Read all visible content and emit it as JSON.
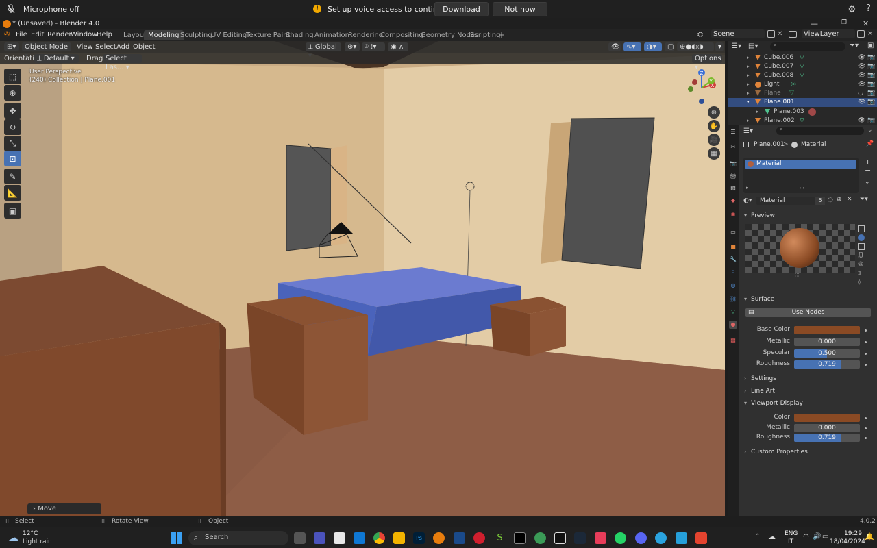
{
  "voice_bar": {
    "mic_label": "Microphone off",
    "warning_text": "Set up voice access to continue",
    "download_label": "Download",
    "not_now_label": "Not now"
  },
  "window": {
    "title": "* (Unsaved) - Blender 4.0"
  },
  "menu": [
    "File",
    "Edit",
    "Render",
    "Window",
    "Help"
  ],
  "workspaces": [
    {
      "label": "Layout",
      "active": false
    },
    {
      "label": "Modeling",
      "active": true
    },
    {
      "label": "Sculpting",
      "active": false
    },
    {
      "label": "UV Editing",
      "active": false
    },
    {
      "label": "Texture Paint",
      "active": false
    },
    {
      "label": "Shading",
      "active": false
    },
    {
      "label": "Animation",
      "active": false
    },
    {
      "label": "Rendering",
      "active": false
    },
    {
      "label": "Compositing",
      "active": false
    },
    {
      "label": "Geometry Nodes",
      "active": false
    },
    {
      "label": "Scripting",
      "active": false
    }
  ],
  "add_workspace": "+",
  "scene": {
    "name": "Scene",
    "view_layer": "ViewLayer"
  },
  "viewport": {
    "mode": "Object Mode",
    "menus": [
      "View",
      "Select",
      "Add",
      "Object"
    ],
    "transform_orientation": "Global",
    "orientation_label": "Orientation:",
    "orientation_value": "Default",
    "drag_label": "Drag:",
    "drag_value": "Select Las...",
    "options_label": "Options",
    "perspective": "User Perspective",
    "collection_info": "(240) Collection | Plane.001",
    "last_op": "Move",
    "gizmo_axes": {
      "x": "X",
      "y": "Y",
      "z": "Z"
    }
  },
  "outliner": {
    "items": [
      {
        "name": "Cube.006",
        "type": "mesh",
        "selected": false
      },
      {
        "name": "Cube.007",
        "type": "mesh",
        "selected": false
      },
      {
        "name": "Cube.008",
        "type": "mesh",
        "selected": false
      },
      {
        "name": "Light",
        "type": "light",
        "selected": false
      },
      {
        "name": "Plane",
        "type": "mesh",
        "selected": false
      },
      {
        "name": "Plane.001",
        "type": "mesh",
        "selected": true
      },
      {
        "name": "Plane.003",
        "type": "mesh",
        "selected": false
      },
      {
        "name": "Plane.002",
        "type": "mesh",
        "selected": false
      }
    ]
  },
  "properties": {
    "breadcrumb_object": "Plane.001",
    "breadcrumb_sep": ">",
    "breadcrumb_tab": "Material",
    "slot_name": "Material",
    "material_name": "Material",
    "user_count": "5",
    "sections": {
      "preview": "Preview",
      "surface": "Surface",
      "settings": "Settings",
      "line_art": "Line Art",
      "viewport_display": "Viewport Display",
      "custom_properties": "Custom Properties"
    },
    "use_nodes_label": "Use Nodes",
    "surface_props": [
      {
        "label": "Base Color",
        "kind": "color"
      },
      {
        "label": "Metallic",
        "value": "0.000",
        "fraction": 0.0
      },
      {
        "label": "Specular",
        "value": "0.500",
        "fraction": 0.5
      },
      {
        "label": "Roughness",
        "value": "0.719",
        "fraction": 0.719
      }
    ],
    "display_props": [
      {
        "label": "Color",
        "kind": "color"
      },
      {
        "label": "Metallic",
        "value": "0.000",
        "fraction": 0.0
      },
      {
        "label": "Roughness",
        "value": "0.719",
        "fraction": 0.719
      }
    ],
    "base_color": "#8a4a24"
  },
  "status_bar": {
    "select": "Select",
    "rotate_view": "Rotate View",
    "object": "Object",
    "version": "4.0.2"
  },
  "taskbar": {
    "weather_temp": "12°C",
    "weather_desc": "Light rain",
    "search_placeholder": "Search",
    "lang_top": "ENG",
    "lang_bottom": "IT",
    "time": "19:29",
    "date": "18/04/2024"
  },
  "colors": {
    "wall": "#d8bc92",
    "floor": "#8a5a44",
    "bed": "#4a64b4",
    "accent": "#4772b3"
  }
}
